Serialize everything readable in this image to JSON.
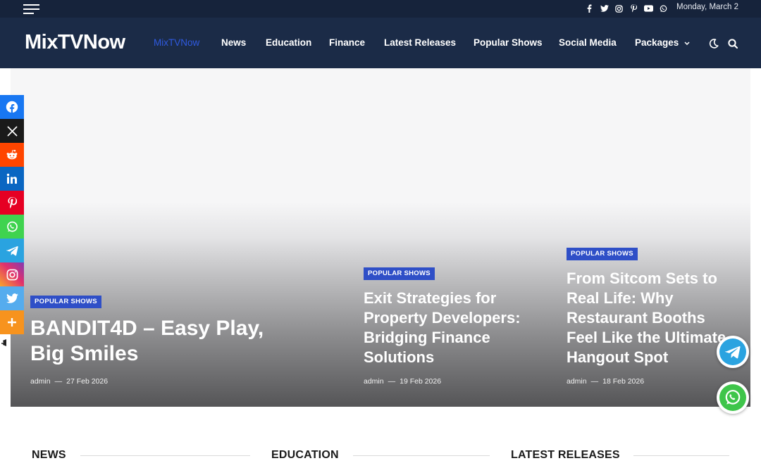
{
  "topbar": {
    "date": "Monday, March 2",
    "social_icons": [
      "facebook-icon",
      "twitter-icon",
      "instagram-icon",
      "pinterest-icon",
      "youtube-icon",
      "whatsapp-icon"
    ]
  },
  "header": {
    "logo": "MixTVNow",
    "nav": [
      "MixTVNow",
      "News",
      "Education",
      "Finance",
      "Latest Releases",
      "Popular Shows",
      "Social Media",
      "Packages"
    ],
    "active_nav": "MixTVNow",
    "icons": [
      "dark-mode-icon",
      "search-icon"
    ]
  },
  "hero": {
    "posts": [
      {
        "category": "POPULAR SHOWS",
        "title_lines": [
          "BANDIT4D – Easy Play,",
          "Big Smiles"
        ],
        "author": "admin",
        "date": "27 Feb 2026"
      },
      {
        "category": "POPULAR SHOWS",
        "title_lines": [
          "Exit Strategies for",
          "Property Developers:",
          "Bridging Finance",
          "Solutions"
        ],
        "author": "admin",
        "date": "19 Feb 2026"
      },
      {
        "category": "POPULAR SHOWS",
        "title_lines": [
          "From Sitcom Sets to",
          "Real Life: Why",
          "Restaurant Booths",
          "Feel Like the Ultimate",
          "Hangout Spot"
        ],
        "author": "admin",
        "date": "18 Feb 2026"
      }
    ]
  },
  "share_bar": [
    "facebook",
    "x",
    "reddit",
    "linkedin",
    "pinterest",
    "whatsapp",
    "telegram",
    "instagram",
    "twitter",
    "more"
  ],
  "sections": [
    "NEWS",
    "EDUCATION",
    "LATEST RELEASES"
  ],
  "colors": {
    "topbar": "#16233b",
    "header": "#1b2b47",
    "accent": "#2f4fc7",
    "active_nav": "#2f5ae0"
  }
}
